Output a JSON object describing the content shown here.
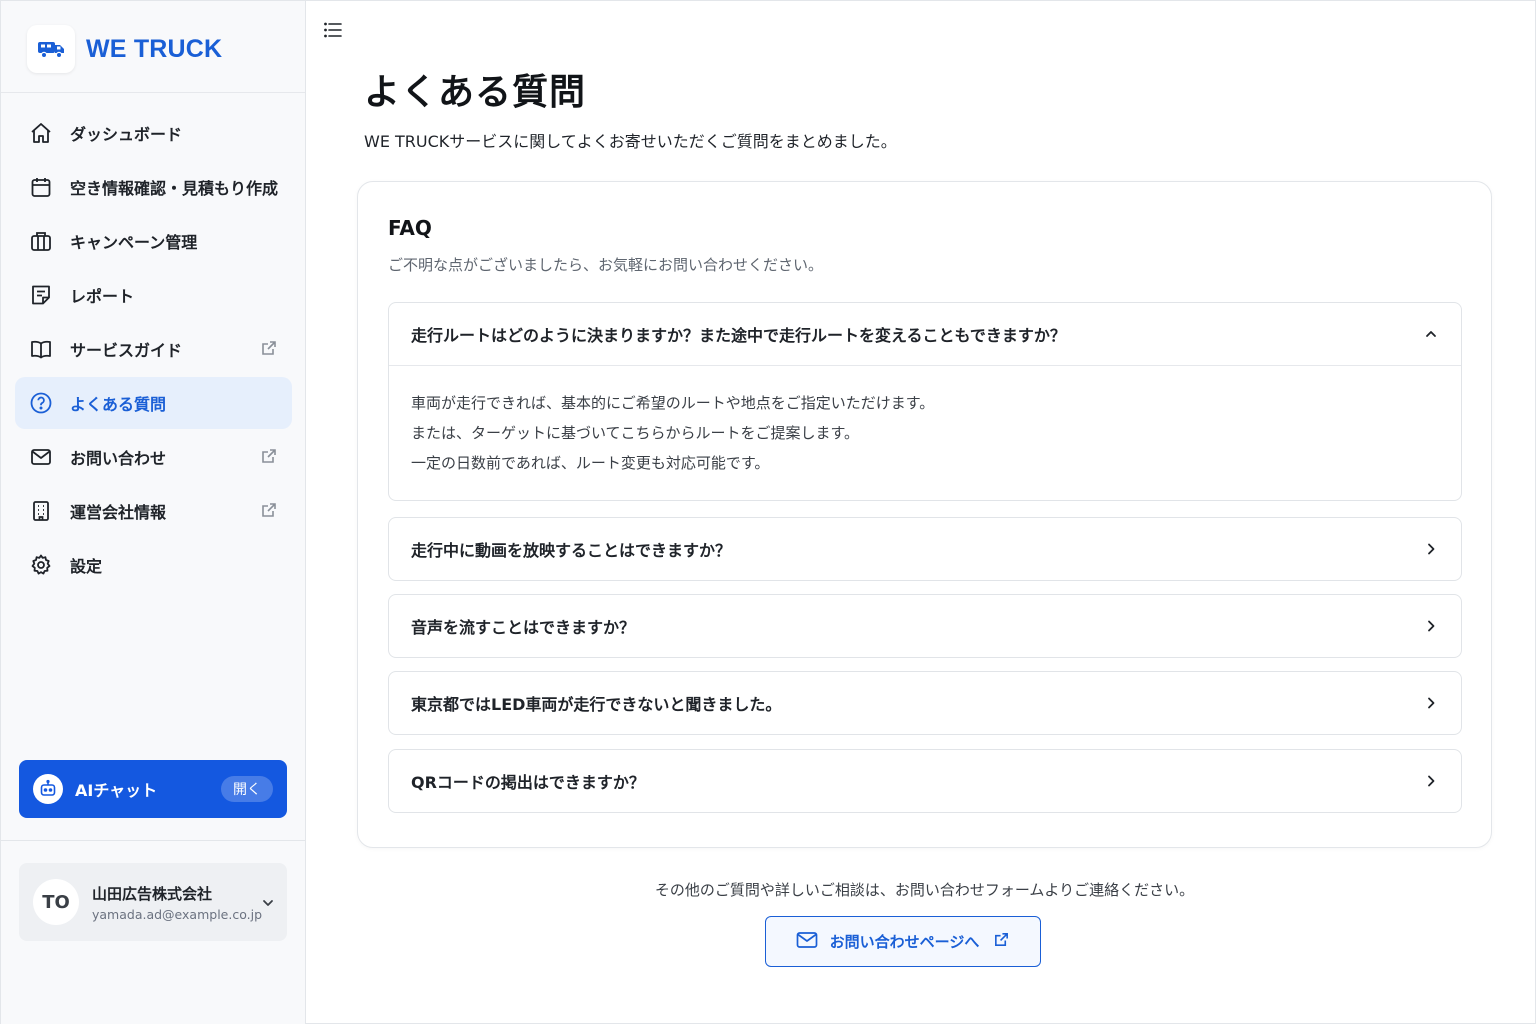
{
  "brand": {
    "name": "WE TRUCK"
  },
  "sidebar": {
    "items": [
      {
        "label": "ダッシュボード",
        "icon": "home-icon",
        "external": false,
        "active": false
      },
      {
        "label": "空き情報確認・見積もり作成",
        "icon": "calendar-icon",
        "external": false,
        "active": false
      },
      {
        "label": "キャンペーン管理",
        "icon": "briefcase-icon",
        "external": false,
        "active": false
      },
      {
        "label": "レポート",
        "icon": "report-icon",
        "external": false,
        "active": false
      },
      {
        "label": "サービスガイド",
        "icon": "book-icon",
        "external": true,
        "active": false
      },
      {
        "label": "よくある質問",
        "icon": "help-circle-icon",
        "external": false,
        "active": true
      },
      {
        "label": "お問い合わせ",
        "icon": "mail-icon",
        "external": true,
        "active": false
      },
      {
        "label": "運営会社情報",
        "icon": "building-icon",
        "external": true,
        "active": false
      },
      {
        "label": "設定",
        "icon": "gear-icon",
        "external": false,
        "active": false
      }
    ],
    "ai_chat": {
      "label": "AIチャット",
      "open_label": "開く"
    },
    "account": {
      "initials": "TO",
      "company": "山田広告株式会社",
      "email": "yamada.ad@example.co.jp"
    }
  },
  "main": {
    "title": "よくある質問",
    "description": "WE TRUCKサービスに関してよくお寄せいただくご質問をまとめました。",
    "faq": {
      "title": "FAQ",
      "subtitle": "ご不明な点がございましたら、お気軽にお問い合わせください。",
      "items": [
        {
          "question": "走行ルートはどのように決まりますか？また途中で走行ルートを変えることもできますか？",
          "expanded": true,
          "answer": [
            "車両が走行できれば、基本的にご希望のルートや地点をご指定いただけます。",
            "または、ターゲットに基づいてこちらからルートをご提案します。",
            "一定の日数前であれば、ルート変更も対応可能です。"
          ]
        },
        {
          "question": "走行中に動画を放映することはできますか？",
          "expanded": false
        },
        {
          "question": "音声を流すことはできますか？",
          "expanded": false
        },
        {
          "question": "東京都ではLED車両が走行できないと聞きました。",
          "expanded": false
        },
        {
          "question": "QRコードの掲出はできますか？",
          "expanded": false
        }
      ]
    },
    "footer_note": "その他のご質問や詳しいご相談は、お問い合わせフォームよりご連絡ください。",
    "contact_button": "お問い合わせページへ"
  },
  "colors": {
    "accent": "#1a5fd6",
    "ai_button": "#1458e0",
    "active_bg": "#e6effc"
  }
}
